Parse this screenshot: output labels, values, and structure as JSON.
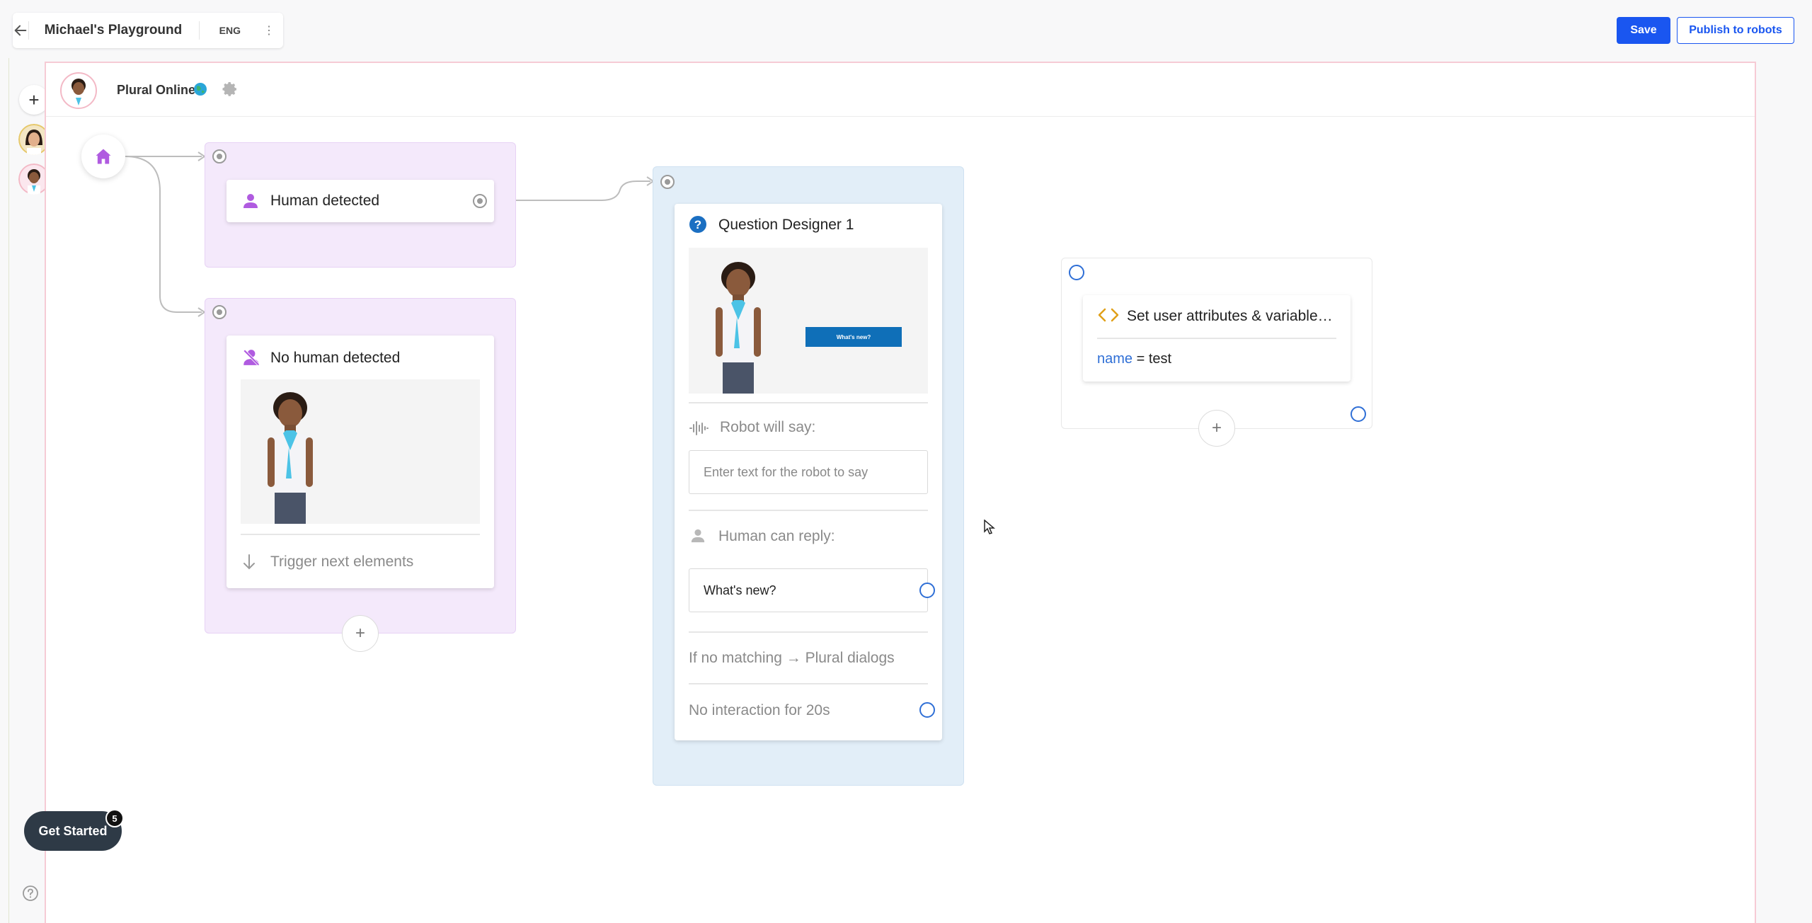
{
  "header": {
    "back_label": "←",
    "title": "Michael's Playground",
    "language": "ENG",
    "more_label": "⋮",
    "save_label": "Save",
    "publish_label": "Publish to robots"
  },
  "sidebar": {
    "add_label": "+"
  },
  "canvas": {
    "robot_name": "Plural Online"
  },
  "nodes": {
    "human_detected": {
      "title": "Human detected"
    },
    "no_human_detected": {
      "title": "No human detected",
      "footer": "Trigger next elements",
      "add_label": "+"
    },
    "question_designer": {
      "title": "Question Designer 1",
      "preview_button_label": "What's new?",
      "robot_say_label": "Robot will say:",
      "robot_say_placeholder": "Enter text for the robot to say",
      "human_reply_label": "Human can reply:",
      "reply_option": "What's new?",
      "no_match_label": "If no matching → Plural dialogs",
      "no_interaction_label": "No interaction for 20s"
    },
    "set_attributes": {
      "title": "Set user attributes & variable…",
      "attr_name": "name",
      "attr_op": "=",
      "attr_value": "test",
      "add_label": "+"
    }
  },
  "get_started": {
    "label": "Get Started",
    "badge": "5"
  },
  "colors": {
    "accent": "#1a56f0",
    "purple_group": "#f4e9fb",
    "blue_group": "#e2eef8",
    "purple_icon": "#b05be0",
    "port_blue": "#2f6fd6"
  }
}
